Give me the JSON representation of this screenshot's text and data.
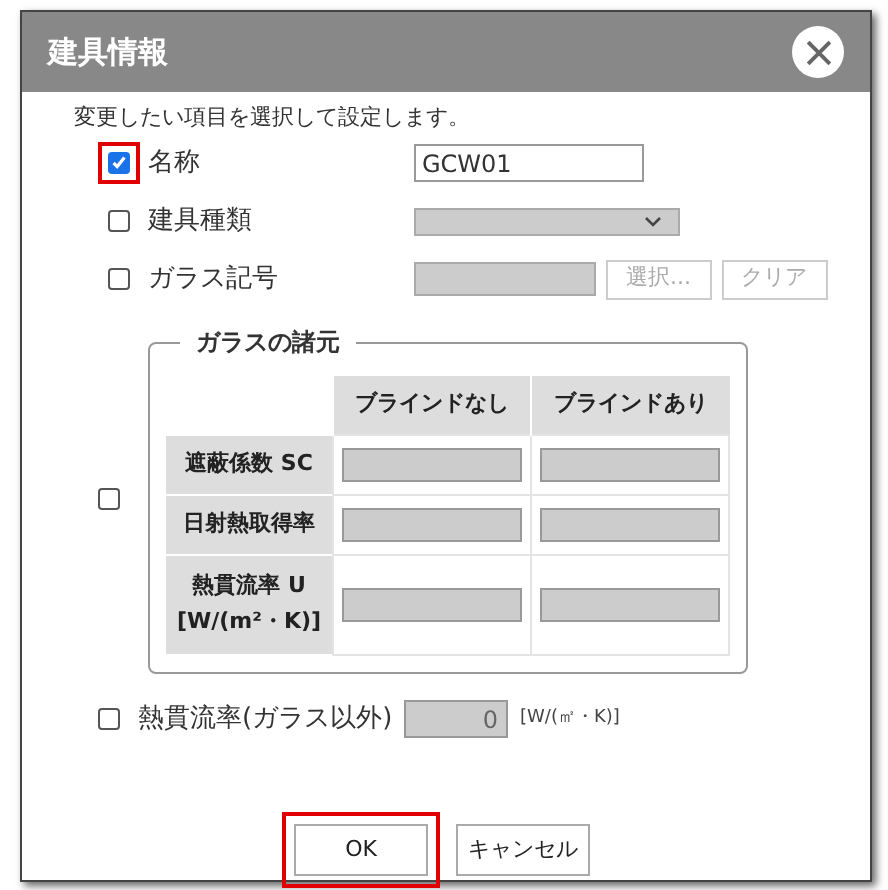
{
  "dialog": {
    "title": "建具情報",
    "instruction": "変更したい項目を選択して設定します。"
  },
  "fields": [
    {
      "kind": "text",
      "label": "名称",
      "checked": true,
      "highlighted": true,
      "value": "GCW01"
    },
    {
      "kind": "select",
      "label": "建具種類",
      "checked": false,
      "highlighted": false
    },
    {
      "kind": "picker",
      "label": "ガラス記号",
      "checked": false,
      "highlighted": false,
      "buttons": [
        {
          "label": "選択...",
          "disabled": true
        },
        {
          "label": "クリア",
          "disabled": true
        }
      ]
    }
  ],
  "glass": {
    "legend": "ガラスの諸元",
    "checked": false,
    "columns": [
      "ブラインドなし",
      "ブラインドあり"
    ],
    "rows": [
      {
        "label": "遮蔽係数 SC"
      },
      {
        "label": "日射熱取得率"
      },
      {
        "label": "熱貫流率 U",
        "sublabel": "[W/(m²・K)]"
      }
    ]
  },
  "other": {
    "label": "熱貫流率(ガラス以外)",
    "checked": false,
    "value": "0",
    "unit": "[W/(㎡・K)]"
  },
  "buttons": [
    {
      "label": "OK",
      "highlighted": true
    },
    {
      "label": "キャンセル",
      "highlighted": false
    }
  ]
}
